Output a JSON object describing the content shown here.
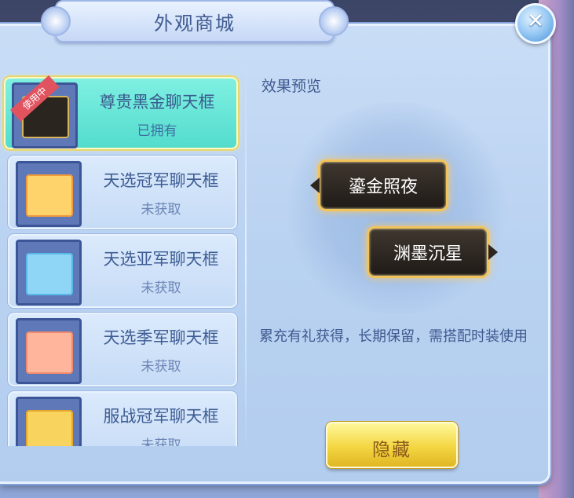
{
  "window": {
    "title": "外观商城",
    "close_icon": "close-icon"
  },
  "list": {
    "items": [
      {
        "name": "尊贵黑金聊天框",
        "status": "已拥有",
        "badge": "使用中",
        "selected": true,
        "frame_color": "#2b2520"
      },
      {
        "name": "天选冠军聊天框",
        "status": "未获取",
        "badge": "",
        "selected": false,
        "frame_color": "#ffd36b"
      },
      {
        "name": "天选亚军聊天框",
        "status": "未获取",
        "badge": "",
        "selected": false,
        "frame_color": "#8fd6f6"
      },
      {
        "name": "天选季军聊天框",
        "status": "未获取",
        "badge": "",
        "selected": false,
        "frame_color": "#ffb59c"
      },
      {
        "name": "服战冠军聊天框",
        "status": "未获取",
        "badge": "",
        "selected": false,
        "frame_color": "#f8d35e"
      }
    ]
  },
  "preview": {
    "label": "效果预览",
    "bubble_left": "鎏金照夜",
    "bubble_right": "渊墨沉星",
    "description": "累充有礼获得，长期保留，需搭配时装使用"
  },
  "actions": {
    "hide_label": "隐藏"
  },
  "colors": {
    "panel": "#bcd3f2",
    "selected_item": "#5ee3d4",
    "title_text": "#3f5a8f",
    "button_gold": "#f3d641",
    "bubble_border": "#f3c35b"
  }
}
